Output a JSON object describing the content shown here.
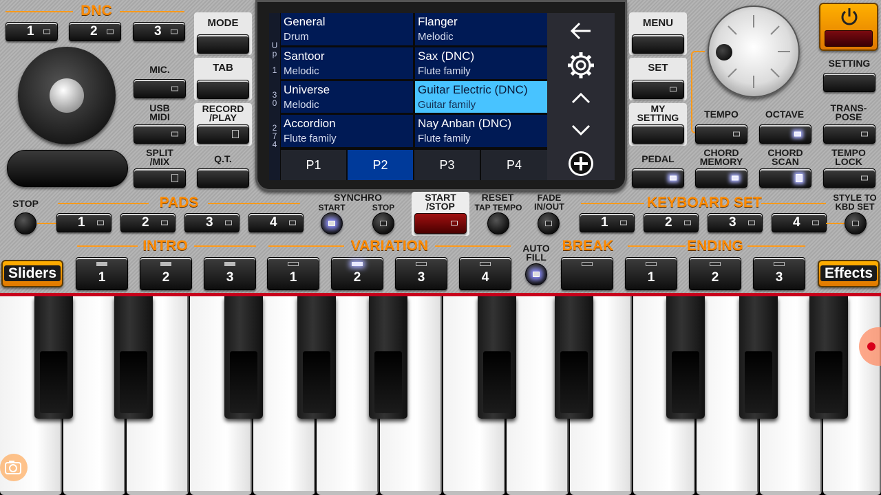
{
  "dnc": {
    "title": "DNC",
    "buttons": [
      "1",
      "2",
      "3"
    ]
  },
  "left_labels": {
    "mic": "MIC.",
    "usb_midi": "USB\nMIDI",
    "split_mix": "SPLIT\n/MIX"
  },
  "mode_col": {
    "mode": "MODE",
    "tab": "TAB",
    "record_play": "RECORD\n/PLAY",
    "qt": "Q.T."
  },
  "screen": {
    "side_text": [
      "U",
      "p",
      "1",
      "3",
      "0",
      "2",
      "7",
      "4"
    ],
    "voices": [
      {
        "name": "General",
        "category": "Drum"
      },
      {
        "name": "Flanger",
        "category": "Melodic"
      },
      {
        "name": "Santoor",
        "category": "Melodic"
      },
      {
        "name": "Sax (DNC)",
        "category": "Flute family"
      },
      {
        "name": "Universe",
        "category": "Melodic"
      },
      {
        "name": "Guitar Electric (DNC)",
        "category": "Guitar family"
      },
      {
        "name": "Accordion",
        "category": "Flute family"
      },
      {
        "name": "Nay Anban (DNC)",
        "category": "Flute family"
      }
    ],
    "selected_voice": "Guitar Electric (DNC)",
    "pages": [
      "P1",
      "P2",
      "P3",
      "P4"
    ],
    "active_page": "P2",
    "icons": [
      "back-arrow-icon",
      "gear-icon",
      "chevron-up-icon",
      "chevron-down-icon",
      "add-icon"
    ]
  },
  "right_col": {
    "menu": "MENU",
    "set": "SET",
    "my_setting": "MY\nSETTING",
    "pedal": "PEDAL"
  },
  "controls": {
    "setting": "SETTING",
    "tempo": "TEMPO",
    "octave": "OCTAVE",
    "transpose": "TRANS-\nPOSE",
    "chord_memory": "CHORD\nMEMORY",
    "chord_scan": "CHORD\nSCAN",
    "tempo_lock": "TEMPO\nLOCK"
  },
  "row_mid": {
    "stop": "STOP",
    "pads": "PADS",
    "pads_buttons": [
      "1",
      "2",
      "3",
      "4"
    ],
    "synchro": "SYNCHRO",
    "synchro_start": "START",
    "synchro_stop": "STOP",
    "start_stop": "START\n/STOP",
    "reset": "RESET",
    "tap_tempo": "TAP TEMPO",
    "fade": "FADE\nIN/OUT",
    "keyboard_set": "KEYBOARD SET",
    "keyboard_set_buttons": [
      "1",
      "2",
      "3",
      "4"
    ],
    "style_to_kbd": "STYLE TO\nKBD SET"
  },
  "row_bottom": {
    "sliders": "Sliders",
    "intro": "INTRO",
    "intro_buttons": [
      "1",
      "2",
      "3"
    ],
    "variation": "VARIATION",
    "variation_buttons": [
      "1",
      "2",
      "3",
      "4"
    ],
    "auto_fill": "AUTO\nFILL",
    "break": "BREAK",
    "ending": "ENDING",
    "ending_buttons": [
      "1",
      "2",
      "3"
    ],
    "effects": "Effects"
  },
  "colors": {
    "accent": "#ff8a00",
    "selected_cell": "#48c3ff",
    "cell_bg": "#001a55",
    "active_tab": "#003a9a",
    "red_line": "#c8001c"
  }
}
